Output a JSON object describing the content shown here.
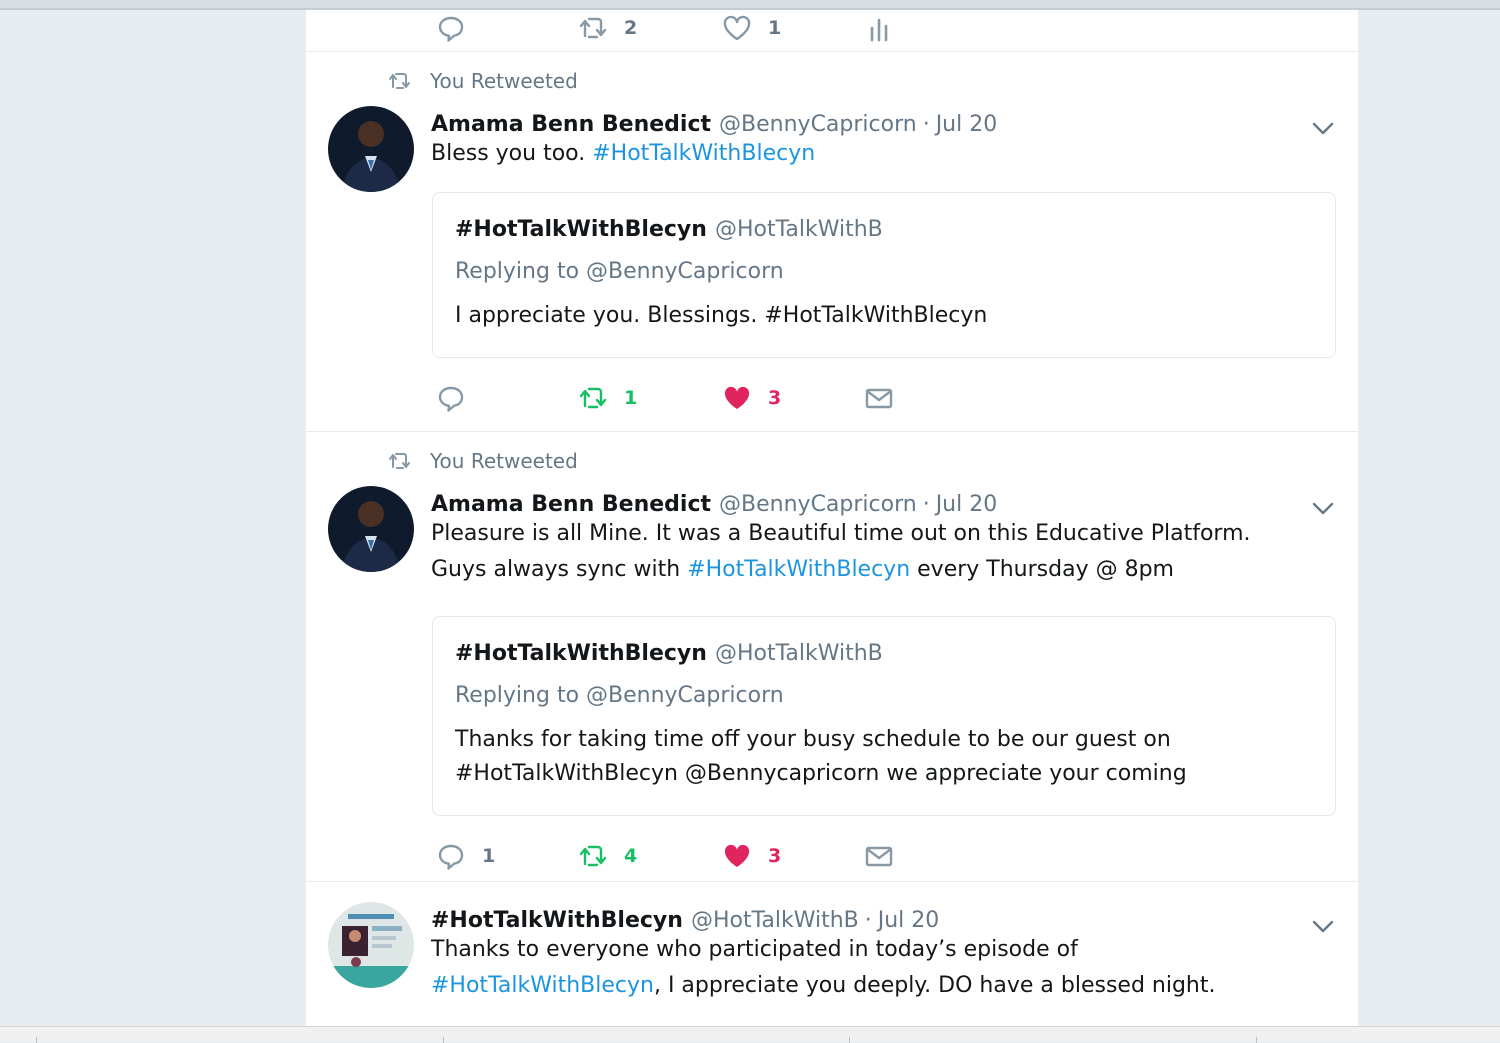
{
  "colors": {
    "link": "#1b95e0",
    "retweet_active": "#17bf63",
    "like_active": "#e0245e",
    "muted": "#657786"
  },
  "partial_tweet": {
    "retweet_count": "2",
    "like_count": "1"
  },
  "tweets": [
    {
      "context": "You Retweeted",
      "fullname": "Amama Benn Benedict",
      "username": "@BennyCapricorn",
      "separator": "·",
      "time": "Jul 20",
      "text_plain": "Bless you too. ",
      "hashtag": "#HotTalkWithBlecyn",
      "quote": {
        "name": "#HotTalkWithBlecyn",
        "username": "@HotTalkWithB",
        "replying_to": "Replying to @BennyCapricorn",
        "text": "I appreciate you. Blessings. #HotTalkWithBlecyn"
      },
      "actions": {
        "reply_icon": "reply-icon",
        "retweet_count": "1",
        "like_count": "3",
        "dm_icon": "envelope-icon"
      }
    },
    {
      "context": "You Retweeted",
      "fullname": "Amama Benn Benedict",
      "username": "@BennyCapricorn",
      "separator": "·",
      "time": "Jul 20",
      "line1": "Pleasure is all Mine. It was a Beautiful time out on this Educative Platform.",
      "line2_prefix": "Guys always sync with ",
      "hashtag": "#HotTalkWithBlecyn",
      "line2_suffix": " every Thursday @ 8pm",
      "quote": {
        "name": "#HotTalkWithBlecyn",
        "username": "@HotTalkWithB",
        "replying_to": "Replying to @BennyCapricorn",
        "text_line1": "Thanks for taking time off your busy schedule to be our guest on",
        "text_line2": "#HotTalkWithBlecyn @Bennycapricorn we appreciate your coming"
      },
      "actions": {
        "reply_count": "1",
        "retweet_count": "4",
        "like_count": "3",
        "dm_icon": "envelope-icon"
      }
    },
    {
      "fullname": "#HotTalkWithBlecyn",
      "username": "@HotTalkWithB",
      "separator": "·",
      "time": "Jul 20",
      "line1": "Thanks to everyone who participated in today’s episode of",
      "hashtag": "#HotTalkWithBlecyn",
      "line2_suffix": ", I appreciate you deeply. DO have a blessed night."
    }
  ]
}
